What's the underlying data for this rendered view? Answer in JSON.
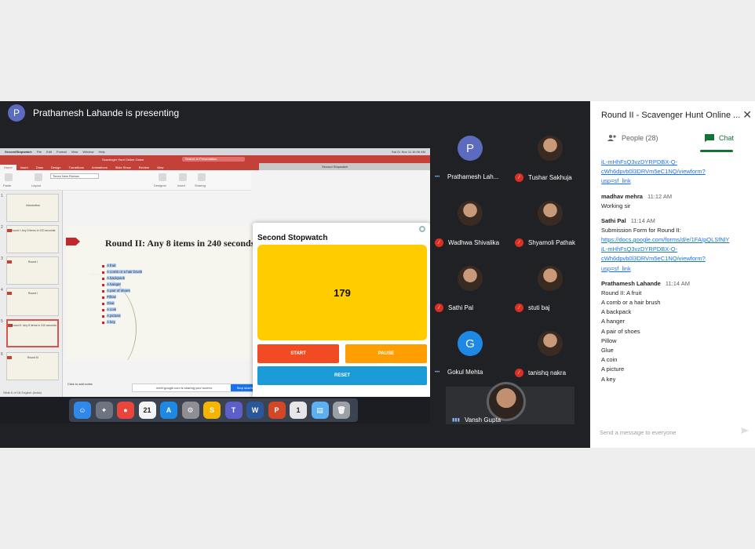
{
  "presenter": {
    "avatar_letter": "P",
    "label": "Prathamesh Lahande is presenting"
  },
  "shared_screen": {
    "menubar": {
      "app": "SecondStopwatch",
      "menus": [
        "File",
        "Edit",
        "Format",
        "View",
        "Window",
        "Help"
      ],
      "clock": "Sat 21 Nov 11:16:06 AM"
    },
    "ppt_title": "Scavenger Hunt Online Game",
    "search_placeholder": "Search in Presentation",
    "tabs": [
      "Home",
      "Insert",
      "Draw",
      "Design",
      "Transitions",
      "Animations",
      "Slide Show",
      "Review",
      "View"
    ],
    "font_name": "Times New Roman",
    "tools": [
      "Paste",
      "Layout",
      "Designer",
      "Insert",
      "Sharing"
    ],
    "thumbnails": [
      {
        "num": "1",
        "title": "Introduction"
      },
      {
        "num": "2",
        "title": "Round I: Any 5 items in 120 seconds"
      },
      {
        "num": "3",
        "title": "Round I"
      },
      {
        "num": "4",
        "title": "Round I"
      },
      {
        "num": "5",
        "title": "Round II"
      },
      {
        "num": "6",
        "title": "Round II: Any 8 items in 240 seconds"
      },
      {
        "num": "7",
        "title": "Round III"
      }
    ],
    "slide": {
      "title": "Round II: Any 8 items in 240 seconds",
      "items": [
        "A fruit",
        "A comb or a hair brush",
        "A backpack",
        "A hanger",
        "A pair of shoes",
        "Pillow",
        "Glue",
        "A coin",
        "A picture",
        "A key"
      ]
    },
    "notes_placeholder": "Click to add notes",
    "status_left": "Slide 6 of 18   English (India)",
    "share_notice": "meet.google.com is sharing your screen.",
    "stop_sharing_label": "Stop sharing",
    "hide_label": "Hide",
    "bg_window_title": "Second Stopwatch",
    "bg_chat_lines": [
      "A coin",
      "A picture",
      "A key"
    ],
    "bg_chat_placeholder": "Send a message to everyone"
  },
  "stopwatch": {
    "title": "Second Stopwatch",
    "value": "179",
    "start_label": "START",
    "pause_label": "PAUSE",
    "reset_label": "RESET",
    "colors": {
      "display": "#ffcc00",
      "start": "#f04b23",
      "pause": "#ff9e00",
      "reset": "#1a9bd7"
    }
  },
  "dock": {
    "apps": [
      {
        "name": "finder-icon",
        "glyph": "☺",
        "color": "#2f88ea"
      },
      {
        "name": "launchpad-icon",
        "glyph": "✦",
        "color": "#6d7480"
      },
      {
        "name": "chrome-icon",
        "glyph": "●",
        "color": "#e8453c"
      },
      {
        "name": "calendar-icon",
        "glyph": "21",
        "color": "#f5f5f5"
      },
      {
        "name": "app-store-icon",
        "glyph": "A",
        "color": "#1e88e5"
      },
      {
        "name": "system-preferences-icon",
        "glyph": "⚙",
        "color": "#8e8e93"
      },
      {
        "name": "slides-icon",
        "glyph": "S",
        "color": "#f4b400"
      },
      {
        "name": "teams-icon",
        "glyph": "T",
        "color": "#5b5fc7"
      },
      {
        "name": "word-icon",
        "glyph": "W",
        "color": "#2b579a"
      },
      {
        "name": "powerpoint-icon",
        "glyph": "P",
        "color": "#d24726"
      },
      {
        "name": "stopwatch-icon",
        "glyph": "1",
        "color": "#e6e6e6"
      },
      {
        "name": "downloads-icon",
        "glyph": "▤",
        "color": "#5ab0f0"
      },
      {
        "name": "trash-icon",
        "glyph": "🗑",
        "color": "#9aa0a6"
      }
    ]
  },
  "participants": [
    {
      "name": "Prathamesh Lah...",
      "avatar_letter": "P",
      "avatar_color": "#5c6bc0",
      "mic": "talking"
    },
    {
      "name": "Tushar Sakhuja",
      "avatar_letter": "",
      "avatar_color": "",
      "mic": "off"
    },
    {
      "name": "Wadhwa Shivalika",
      "avatar_letter": "",
      "avatar_color": "",
      "mic": "off"
    },
    {
      "name": "Shyamoli Pathak",
      "avatar_letter": "",
      "avatar_color": "",
      "mic": "off"
    },
    {
      "name": "Sathi Pal",
      "avatar_letter": "",
      "avatar_color": "",
      "mic": "off"
    },
    {
      "name": "stuti baj",
      "avatar_letter": "",
      "avatar_color": "",
      "mic": "off"
    },
    {
      "name": "Gokul Mehta",
      "avatar_letter": "G",
      "avatar_color": "#1e88e5",
      "mic": "talking"
    },
    {
      "name": "tanishq nakra",
      "avatar_letter": "",
      "avatar_color": "",
      "mic": "off"
    }
  ],
  "active_speaker": {
    "name": "Vansh Gupta"
  },
  "panel": {
    "title": "Round II - Scavenger Hunt Online ...",
    "people_label": "People (28)",
    "chat_label": "Chat",
    "messages": [
      {
        "sender": "",
        "time": "",
        "lines": [
          {
            "text": "iL-mHhFsQ3vzDYRPDBX-Q-",
            "link": true
          },
          {
            "text": "cWh6dpvb0l3DRVm5eC1NQ/viewform?",
            "link": true
          },
          {
            "text": "usp=sf_link",
            "link": true
          }
        ]
      },
      {
        "sender": "madhav mehra",
        "time": "11:12 AM",
        "lines": [
          {
            "text": "Working sir",
            "link": false
          }
        ]
      },
      {
        "sender": "Sathi Pal",
        "time": "11:14 AM",
        "lines": [
          {
            "text": "Submission Form for Round II:",
            "link": false
          },
          {
            "text": "https://docs.google.com/forms/d/e/1FAIpQLSfNlY",
            "link": true
          },
          {
            "text": "iL-mHhFsQ3vzDYRPDBX-Q-",
            "link": true
          },
          {
            "text": "cWh6dpvb0l3DRVm5eC1NQ/viewform?",
            "link": true
          },
          {
            "text": "usp=sf_link",
            "link": true
          }
        ]
      },
      {
        "sender": "Prathamesh Lahande",
        "time": "11:14 AM",
        "lines": [
          {
            "text": "Round II: A fruit",
            "link": false
          },
          {
            "text": "A comb or a hair brush",
            "link": false
          },
          {
            "text": "A backpack",
            "link": false
          },
          {
            "text": "A hanger",
            "link": false
          },
          {
            "text": "A pair of shoes",
            "link": false
          },
          {
            "text": "Pillow",
            "link": false
          },
          {
            "text": "Glue",
            "link": false
          },
          {
            "text": "A coin",
            "link": false
          },
          {
            "text": "A picture",
            "link": false
          },
          {
            "text": "A key",
            "link": false
          }
        ]
      }
    ],
    "input_placeholder": "Send a message to everyone"
  }
}
